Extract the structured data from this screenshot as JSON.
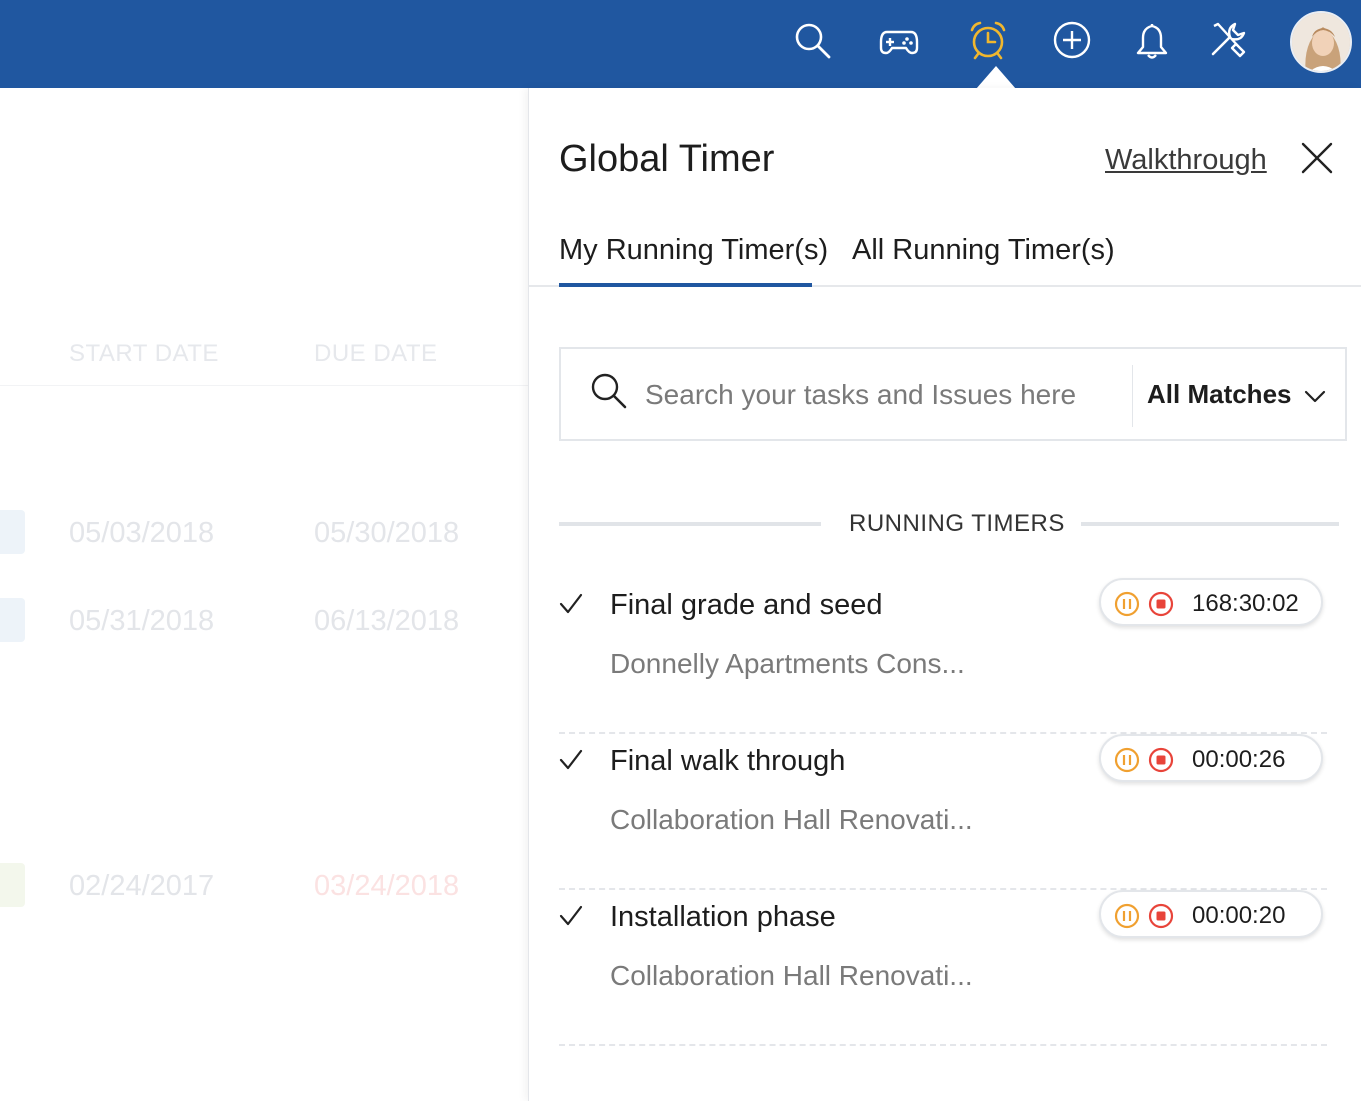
{
  "colors": {
    "topbar": "#2057a0",
    "active_icon": "#f0b72f",
    "pause": "#f0a030",
    "stop": "#e8443a",
    "tab_active": "#2057a0"
  },
  "topbar": {
    "icons": [
      "search-icon",
      "gamepad-icon",
      "alarm-clock-icon",
      "plus-circle-icon",
      "bell-icon",
      "tools-icon"
    ],
    "active": "alarm-clock-icon"
  },
  "background": {
    "headers": {
      "start": "START DATE",
      "due": "DUE DATE"
    },
    "rows": [
      {
        "start": "05/03/2018",
        "due": "05/30/2018"
      },
      {
        "start": "05/31/2018",
        "due": "06/13/2018"
      },
      {
        "start": "02/24/2017",
        "due": "03/24/2018"
      }
    ]
  },
  "panel": {
    "title": "Global Timer",
    "walkthrough": "Walkthrough",
    "tabs": [
      "My Running Timer(s)",
      "All Running Timer(s)"
    ],
    "active_tab": 0,
    "search": {
      "placeholder": "Search your tasks and Issues here",
      "value": "",
      "filter": "All Matches"
    },
    "section_label": "RUNNING TIMERS",
    "timers": [
      {
        "task": "Final grade and seed",
        "project": "Donnelly Apartments Cons...",
        "time": "168:30:02"
      },
      {
        "task": "Final walk through",
        "project": "Collaboration Hall Renovati...",
        "time": "00:00:26"
      },
      {
        "task": "Installation phase",
        "project": "Collaboration Hall Renovati...",
        "time": "00:00:20"
      }
    ]
  }
}
